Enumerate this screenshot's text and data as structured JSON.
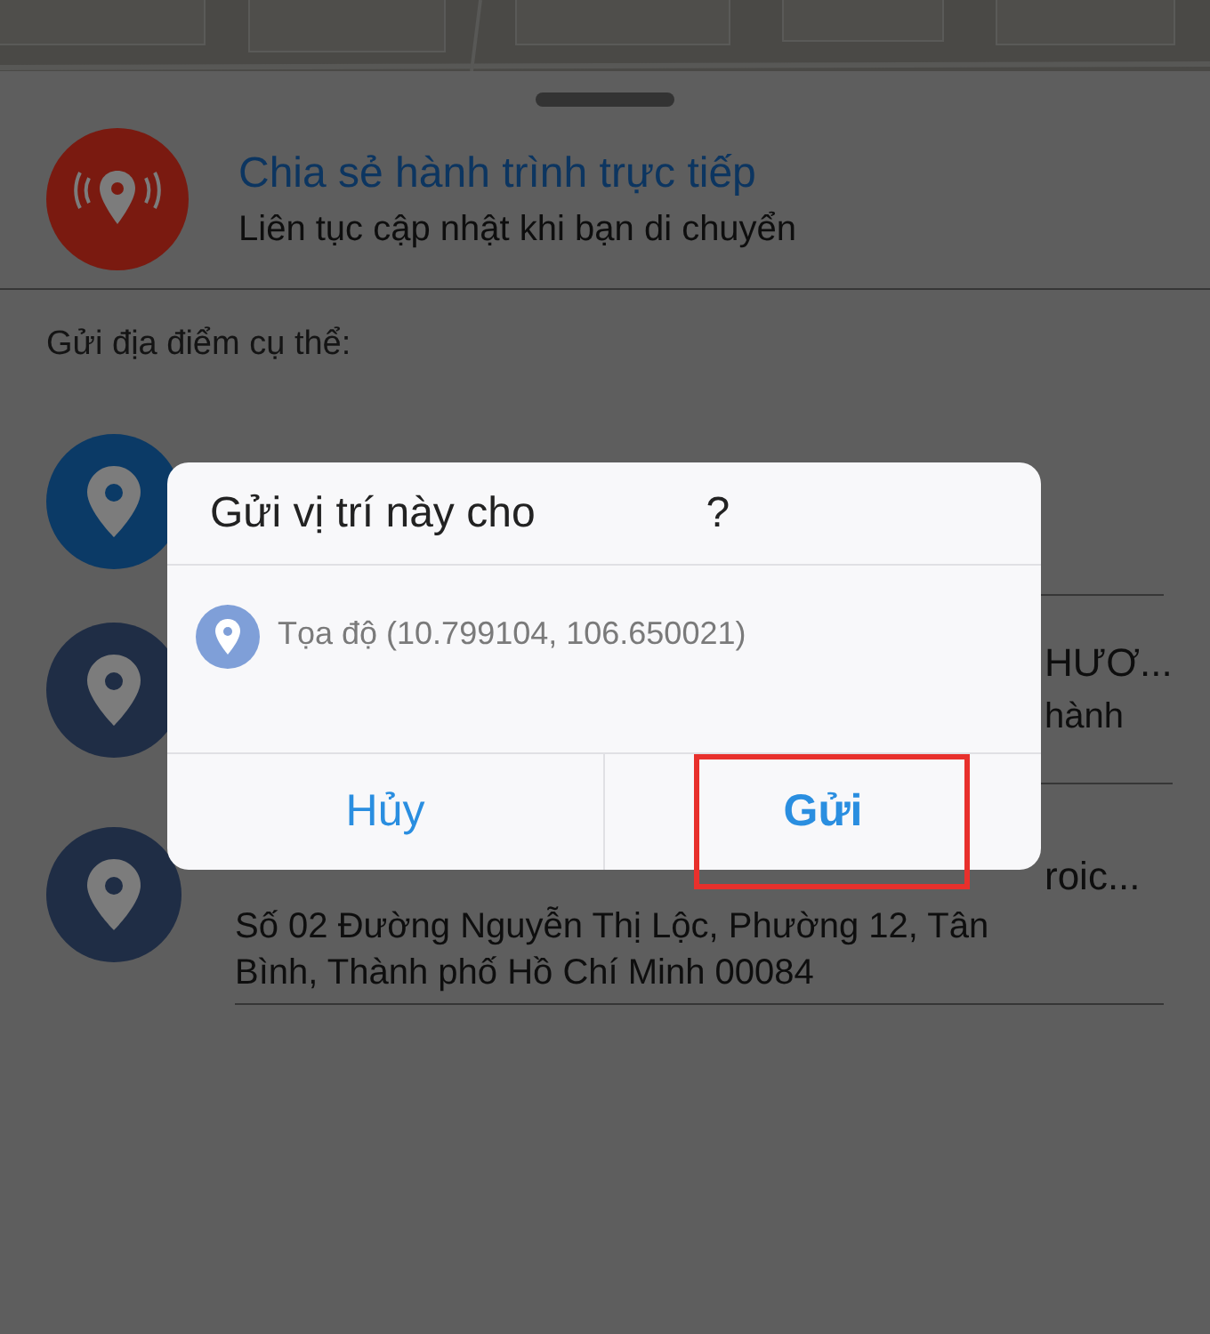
{
  "live_share": {
    "title": "Chia sẻ hành trình trực tiếp",
    "subtitle": "Liên tục cập nhật khi bạn di chuyển"
  },
  "section_label": "Gửi địa điểm cụ thể:",
  "places": [
    {
      "kind": "current"
    },
    {
      "kind": "saved",
      "title": "HƯƠ...",
      "subtitle": "hành"
    },
    {
      "kind": "saved",
      "title": "roic...",
      "address": "Số 02 Đường Nguyễn Thị Lộc, Phường 12, Tân Bình, Thành phố Hồ Chí Minh 00084"
    }
  ],
  "dialog": {
    "title": "Gửi vị trí này cho",
    "title_end": "?",
    "coordinate": "Tọa độ (10.799104, 106.650021)",
    "buttons": [
      {
        "label": "Hủy",
        "kind": "cancel",
        "highlighted": false
      },
      {
        "label": "Gửi",
        "kind": "default",
        "highlighted": true
      }
    ]
  }
}
